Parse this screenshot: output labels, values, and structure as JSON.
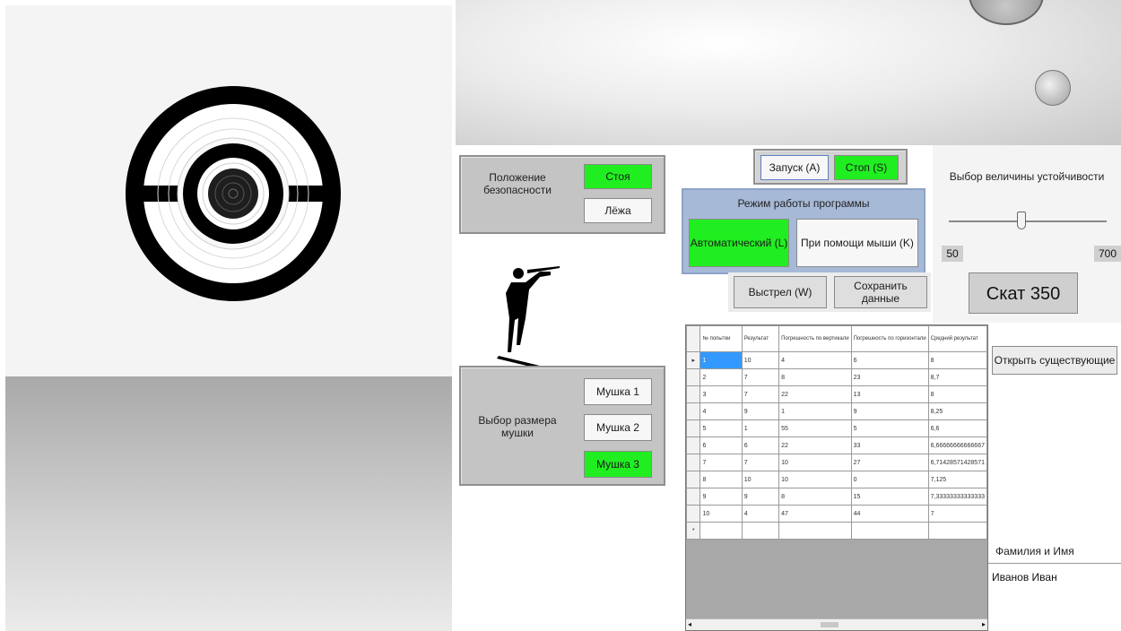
{
  "safety": {
    "label": "Положение безопасности",
    "options": [
      "Стоя",
      "Лёжа"
    ],
    "selected": "Стоя"
  },
  "sight": {
    "label": "Выбор размера мушки",
    "options": [
      "Мушка 1",
      "Мушка 2",
      "Мушка 3"
    ],
    "selected": "Мушка 3"
  },
  "controls": {
    "start": "Запуск (A)",
    "stop": "Стоп (S)",
    "shot": "Выстрел (W)",
    "save": "Сохранить данные"
  },
  "mode": {
    "title": "Режим работы программы",
    "auto": "Автоматический (L)",
    "mouse": "При помощи мыши (K)"
  },
  "stability": {
    "title": "Выбор величины устойчивости",
    "min": "50",
    "max": "700",
    "value_label": "Скат 350",
    "value": 350
  },
  "open_button": "Открыть существующие",
  "user": {
    "label": "Фамилия и Имя",
    "name": "Иванов Иван"
  },
  "table": {
    "headers": [
      "№ попытки",
      "Результат",
      "Погрешность по вертикали",
      "Погрешность по горизонтали",
      "Средний результат"
    ],
    "rows": [
      [
        "1",
        "10",
        "4",
        "6",
        "8"
      ],
      [
        "2",
        "7",
        "8",
        "23",
        "8,7"
      ],
      [
        "3",
        "7",
        "22",
        "13",
        "8"
      ],
      [
        "4",
        "9",
        "1",
        "9",
        "8,25"
      ],
      [
        "5",
        "1",
        "55",
        "5",
        "6,6"
      ],
      [
        "6",
        "6",
        "22",
        "33",
        "6,66666666666667"
      ],
      [
        "7",
        "7",
        "10",
        "27",
        "6,71428571428571"
      ],
      [
        "8",
        "10",
        "10",
        "0",
        "7,125"
      ],
      [
        "9",
        "9",
        "8",
        "15",
        "7,33333333333333"
      ],
      [
        "10",
        "4",
        "47",
        "44",
        "7"
      ]
    ]
  },
  "colors": {
    "active_green": "#21ee21",
    "panel_grey": "#c4c4c4",
    "mode_header_blue": "#a6b9d6"
  }
}
